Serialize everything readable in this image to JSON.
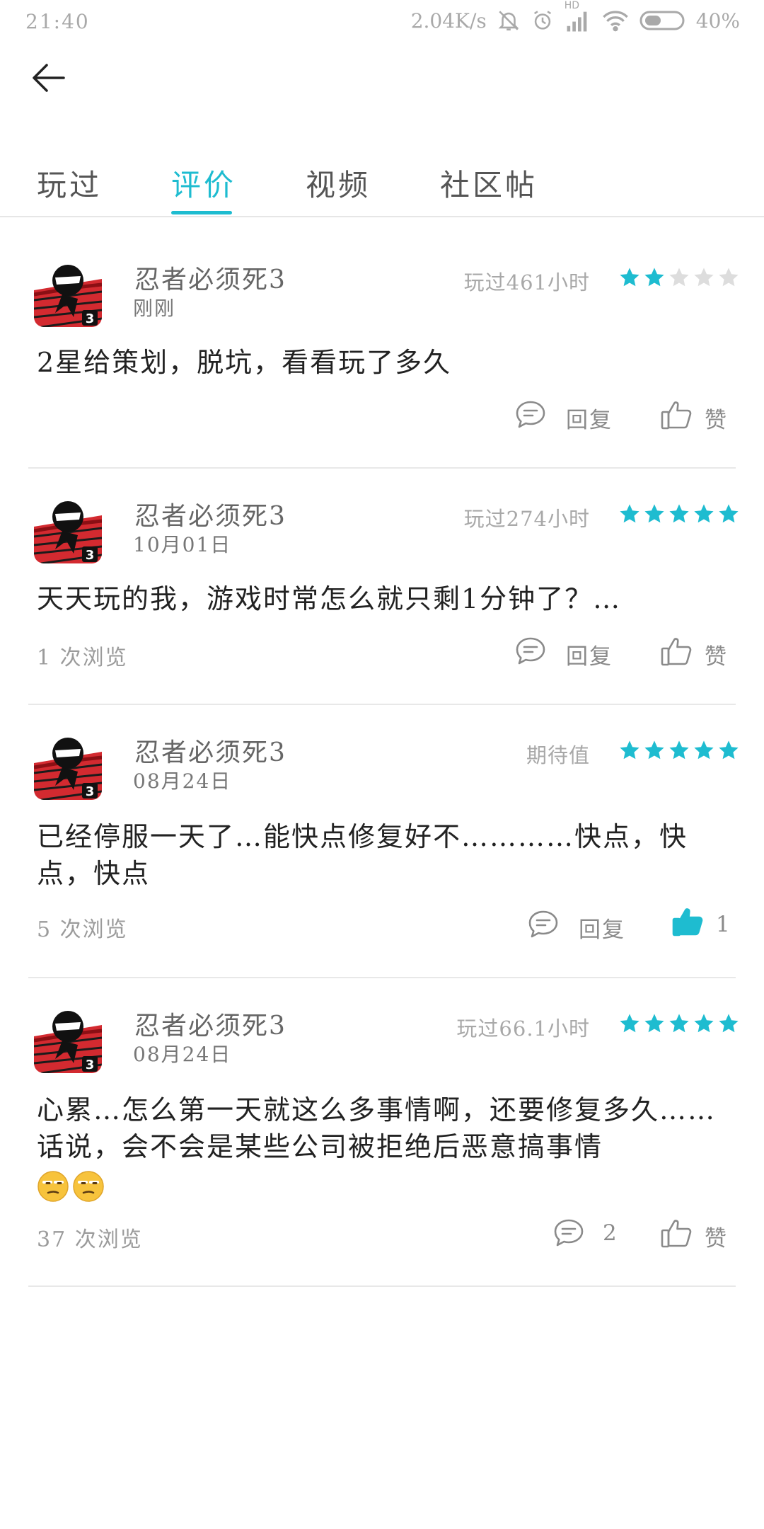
{
  "status_bar": {
    "time": "21:40",
    "speed": "2.04K/s",
    "network": "HD",
    "battery": "40%"
  },
  "tabs": [
    {
      "label": "玩过"
    },
    {
      "label": "评价"
    },
    {
      "label": "视频"
    },
    {
      "label": "社区帖"
    }
  ],
  "active_tab": "评价",
  "accent_color": "#1ebcd0",
  "reviews": [
    {
      "game_name": "忍者必须死3",
      "date": "刚刚",
      "play_info": "玩过461小时",
      "rating": 2,
      "content": "2星给策划，脱坑，看看玩了多久",
      "views": "",
      "reply_label": "回复",
      "like_label": "赞",
      "liked": false
    },
    {
      "game_name": "忍者必须死3",
      "date": "10月01日",
      "play_info": "玩过274小时",
      "rating": 5,
      "content": "天天玩的我，游戏时常怎么就只剩1分钟了？…",
      "views": "1 次浏览",
      "reply_label": "回复",
      "like_label": "赞",
      "liked": false
    },
    {
      "game_name": "忍者必须死3",
      "date": "08月24日",
      "play_info": "期待值",
      "rating": 5,
      "content": "已经停服一天了…能快点修复好不…………快点，快点，快点",
      "views": "5 次浏览",
      "reply_label": "回复",
      "like_label": "1",
      "liked": true
    },
    {
      "game_name": "忍者必须死3",
      "date": "08月24日",
      "play_info": "玩过66.1小时",
      "rating": 5,
      "content": "心累…怎么第一天就这么多事情啊，还要修复多久……话说，会不会是某些公司被拒绝后恶意搞事情",
      "emoji": [
        "unamused-face-icon",
        "unamused-face-icon"
      ],
      "views": "37 次浏览",
      "reply_label": "2",
      "like_label": "赞",
      "liked": false
    }
  ]
}
